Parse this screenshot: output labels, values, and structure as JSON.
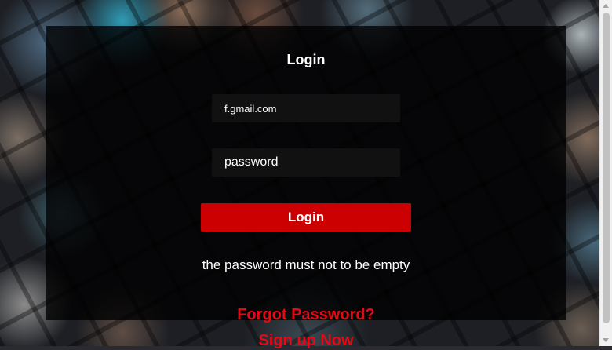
{
  "login": {
    "title": "Login",
    "email_value": "f.gmail.com",
    "password_placeholder": "password",
    "login_button": "Login",
    "error_message": "the password must not to be empty",
    "forgot_password": "Forgot Password?",
    "sign_up": "Sign up Now"
  },
  "colors": {
    "accent": "#e50914",
    "button": "#cc0000",
    "overlay": "rgba(0,0,0,0.78)"
  }
}
